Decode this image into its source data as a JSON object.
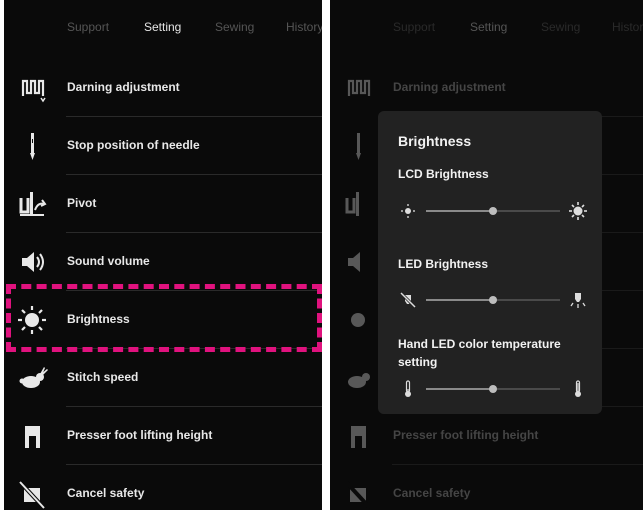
{
  "tabs": [
    "Support",
    "Setting",
    "Sewing",
    "History"
  ],
  "active_tab": "Setting",
  "menu_items": [
    {
      "label": "Darning adjustment",
      "icon": "darning-icon"
    },
    {
      "label": "Stop position of needle",
      "icon": "needle-icon"
    },
    {
      "label": "Pivot",
      "icon": "pivot-icon"
    },
    {
      "label": "Sound volume",
      "icon": "speaker-icon"
    },
    {
      "label": "Brightness",
      "icon": "sun-icon"
    },
    {
      "label": "Stitch speed",
      "icon": "rabbit-icon"
    },
    {
      "label": "Presser foot lifting height",
      "icon": "presser-foot-icon"
    },
    {
      "label": "Cancel safety",
      "icon": "cancel-safety-icon"
    }
  ],
  "highlighted_item": "Brightness",
  "highlight_color": "#e0127e",
  "dialog": {
    "title": "Brightness",
    "lcd": {
      "label": "LCD Brightness",
      "level": 0.5,
      "icon_low": "sun-small-icon",
      "icon_high": "sun-large-icon"
    },
    "led": {
      "label": "LED Brightness",
      "level": 0.5,
      "icon_low": "led-off-icon",
      "icon_high": "led-on-icon"
    },
    "hand_led": {
      "label": "Hand LED color temperature setting",
      "level": 0.5,
      "icon_low": "thermometer-low-icon",
      "icon_high": "thermometer-high-icon"
    }
  }
}
